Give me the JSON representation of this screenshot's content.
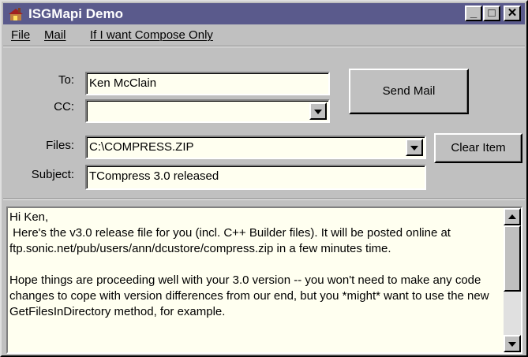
{
  "window": {
    "title": "ISGMapi Demo",
    "minimize_glyph": "_",
    "maximize_glyph": "□",
    "close_glyph": "✕"
  },
  "menu": {
    "items": [
      {
        "label": "File"
      },
      {
        "label": "Mail"
      },
      {
        "label": "If I want Compose Only"
      }
    ]
  },
  "form": {
    "to_label": "To:",
    "to_value": "Ken McClain",
    "cc_label": "CC:",
    "cc_value": "",
    "files_label": "Files:",
    "files_value": "C:\\COMPRESS.ZIP",
    "subject_label": "Subject:",
    "subject_value": "TCompress 3.0 released"
  },
  "buttons": {
    "send_mail": "Send Mail",
    "clear_item": "Clear Item"
  },
  "message": {
    "body": "Hi Ken,\n Here's the v3.0 release file for you (incl. C++ Builder files). It will be posted online at ftp.sonic.net/pub/users/ann/dcustore/compress.zip in a few minutes time.\n\nHope things are proceeding well with your 3.0 version -- you won't need to make any code changes to cope with version differences from our end, but you *might* want to use the new GetFilesInDirectory method, for example."
  }
}
